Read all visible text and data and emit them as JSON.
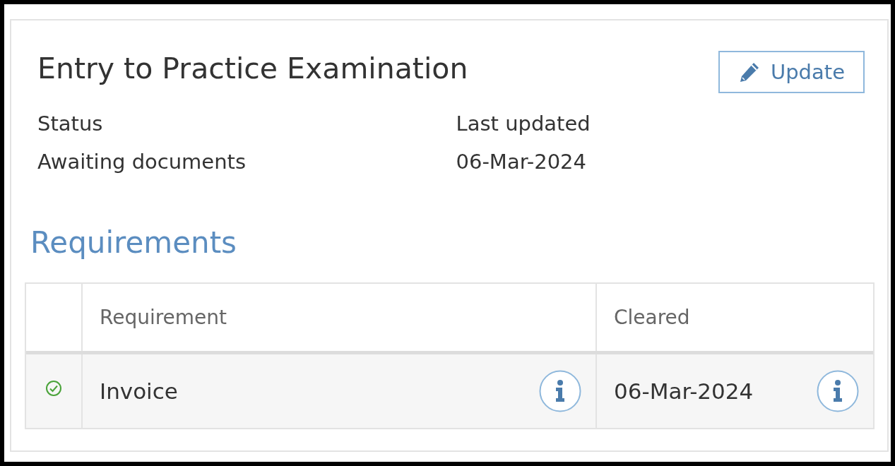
{
  "title": "Entry to Practice Examination",
  "update_button": {
    "label": "Update"
  },
  "fields": [
    {
      "label": "Status",
      "value": "Awaiting documents"
    },
    {
      "label": "Last updated",
      "value": "06-Mar-2024"
    }
  ],
  "requirements": {
    "heading": "Requirements",
    "columns": [
      "Requirement",
      "Cleared"
    ],
    "rows": [
      {
        "cleared": true,
        "requirement": "Invoice",
        "cleared_date": "06-Mar-2024"
      }
    ]
  }
}
